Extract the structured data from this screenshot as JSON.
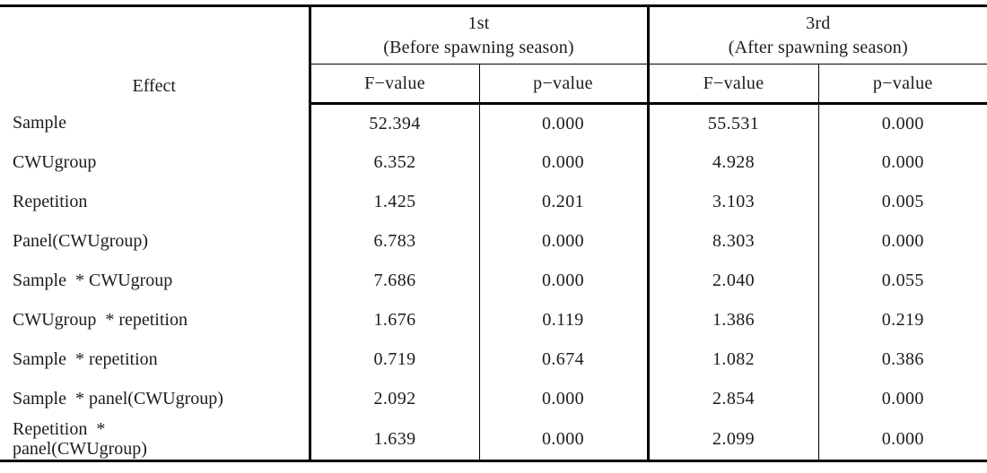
{
  "table": {
    "groups": [
      {
        "id": "first",
        "line1": "1st",
        "line2": "(Before spawning season)"
      },
      {
        "id": "third",
        "line1": "3rd",
        "line2": "(After spawning season)"
      }
    ],
    "columns": {
      "effect": "Effect",
      "f_value": "F−value",
      "p_value": "p−value"
    },
    "rows": [
      {
        "effect": "Sample",
        "effect_line2": "",
        "f1": "52.394",
        "p1": "0.000",
        "f3": "55.531",
        "p3": "0.000"
      },
      {
        "effect": "CWUgroup",
        "effect_line2": "",
        "f1": "6.352",
        "p1": "0.000",
        "f3": "4.928",
        "p3": "0.000"
      },
      {
        "effect": "Repetition",
        "effect_line2": "",
        "f1": "1.425",
        "p1": "0.201",
        "f3": "3.103",
        "p3": "0.005"
      },
      {
        "effect": "Panel(CWUgroup)",
        "effect_line2": "",
        "f1": "6.783",
        "p1": "0.000",
        "f3": "8.303",
        "p3": "0.000"
      },
      {
        "effect": "Sample  * CWUgroup",
        "effect_line2": "",
        "f1": "7.686",
        "p1": "0.000",
        "f3": "2.040",
        "p3": "0.055"
      },
      {
        "effect": "CWUgroup  * repetition",
        "effect_line2": "",
        "f1": "1.676",
        "p1": "0.119",
        "f3": "1.386",
        "p3": "0.219"
      },
      {
        "effect": "Sample  * repetition",
        "effect_line2": "",
        "f1": "0.719",
        "p1": "0.674",
        "f3": "1.082",
        "p3": "0.386"
      },
      {
        "effect": "Sample  * panel(CWUgroup)",
        "effect_line2": "",
        "f1": "2.092",
        "p1": "0.000",
        "f3": "2.854",
        "p3": "0.000"
      },
      {
        "effect": "Repetition  *",
        "effect_line2": "panel(CWUgroup)",
        "f1": "1.639",
        "p1": "0.000",
        "f3": "2.099",
        "p3": "0.000"
      }
    ]
  }
}
